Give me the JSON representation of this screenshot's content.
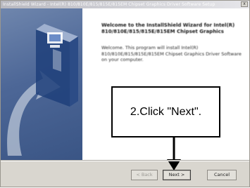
{
  "window": {
    "title": "InstallShield Wizard - Intel(R) 810/810E/815/815E/815EM Chipset Graphics Driver Software Setup",
    "close_glyph": "x"
  },
  "welcome": {
    "heading": "Welcome to the InstallShield Wizard for Intel(R) 810/810E/815/815E/815EM Chipset Graphics",
    "body": "Welcome. This program will install Intel(R) 810/810E/815/815E/815EM Chipset Graphics Driver Software on your computer."
  },
  "callout": {
    "text": "2.Click \"Next\"."
  },
  "buttons": {
    "back": "< Back",
    "next": "Next >",
    "cancel": "Cancel"
  },
  "colors": {
    "panel": "#4d6797",
    "dialog_bg": "#d9d6cf"
  },
  "icons": {
    "wizard_graphic": "installshield-box-icon",
    "arrow": "arrow-down-icon"
  }
}
